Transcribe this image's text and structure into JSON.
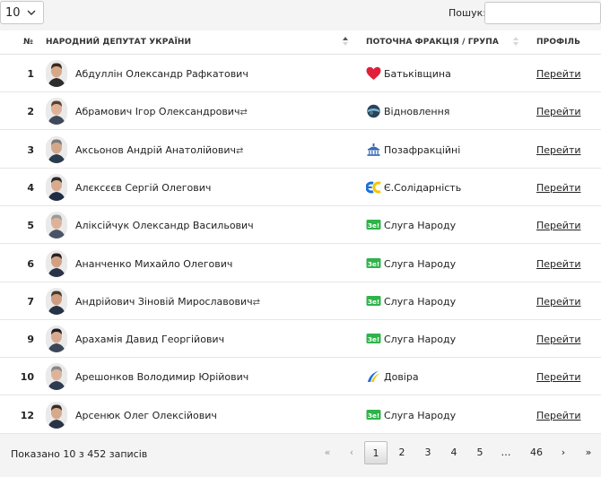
{
  "length": {
    "value": "10"
  },
  "search": {
    "label": "Пошук:",
    "value": ""
  },
  "columns": {
    "num": "№",
    "name": "НАРОДНИЙ ДЕПУТАТ УКРАЇНИ",
    "faction": "ПОТОЧНА ФРАКЦІЯ / ГРУПА",
    "profile": "ПРОФІЛЬ"
  },
  "rows": [
    {
      "num": "1",
      "name": "Абдуллін Олександр Рафкатович",
      "swap": "",
      "party": "Батьківщина",
      "party_icon": "heart-icon",
      "link": "Перейти"
    },
    {
      "num": "2",
      "name": "Абрамович Ігор Олександрович",
      "swap": "⇄",
      "party": "Відновлення",
      "party_icon": "globe-icon",
      "link": "Перейти"
    },
    {
      "num": "3",
      "name": "Аксьонов Андрій Анатолійович",
      "swap": "⇄",
      "party": "Позафракційні",
      "party_icon": "parliament-icon",
      "link": "Перейти"
    },
    {
      "num": "4",
      "name": "Алєксєєв Сергій Олегович",
      "swap": "",
      "party": "Є.Солідарність",
      "party_icon": "es-logo-icon",
      "link": "Перейти"
    },
    {
      "num": "5",
      "name": "Аліксійчук Олександр Васильович",
      "swap": "",
      "party": "Слуга Народу",
      "party_icon": "ze-logo-icon",
      "link": "Перейти"
    },
    {
      "num": "6",
      "name": "Ананченко Михайло Олегович",
      "swap": "",
      "party": "Слуга Народу",
      "party_icon": "ze-logo-icon",
      "link": "Перейти"
    },
    {
      "num": "7",
      "name": "Андрійович Зіновій Мирославович",
      "swap": "⇄",
      "party": "Слуга Народу",
      "party_icon": "ze-logo-icon",
      "link": "Перейти"
    },
    {
      "num": "9",
      "name": "Арахамія Давид Георгійович",
      "swap": "",
      "party": "Слуга Народу",
      "party_icon": "ze-logo-icon",
      "link": "Перейти"
    },
    {
      "num": "10",
      "name": "Арешонков Володимир Юрійович",
      "swap": "",
      "party": "Довіра",
      "party_icon": "wave-logo-icon",
      "link": "Перейти"
    },
    {
      "num": "12",
      "name": "Арсенюк Олег Олексійович",
      "swap": "",
      "party": "Слуга Народу",
      "party_icon": "ze-logo-icon",
      "link": "Перейти"
    }
  ],
  "footer": {
    "info": "Показано 10 з 452 записів",
    "first": "«",
    "prev": "‹",
    "pages": [
      "1",
      "2",
      "3",
      "4",
      "5"
    ],
    "ellipsis": "…",
    "last_page": "46",
    "next": "›",
    "last": "»",
    "current": "1"
  },
  "colors": {
    "heart": "#e0203a",
    "ze": "#2fb34a",
    "es_blue": "#1d6fd8",
    "es_yellow": "#f5c400",
    "link": "#222222"
  }
}
